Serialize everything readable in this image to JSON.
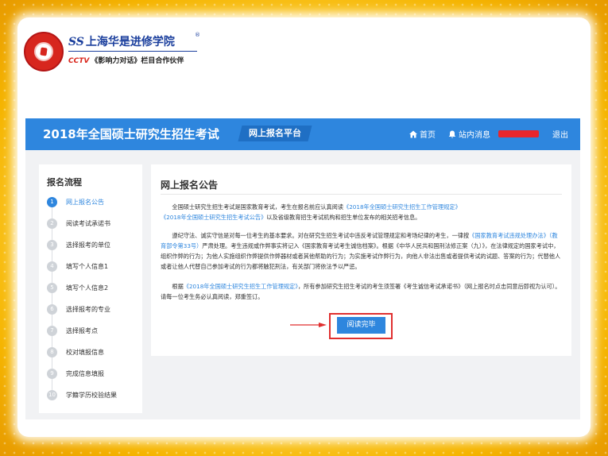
{
  "logo": {
    "school_mark": "SS",
    "school_name": "上海华是进修学院",
    "registered": "®",
    "partner_channel": "CCTV",
    "partner_program": "《影响力对话》",
    "partner_suffix": "栏目合作伙伴"
  },
  "header": {
    "title": "2018年全国硕士研究生招生考试",
    "platform_tag": "网上报名平台",
    "nav": {
      "home": "首页",
      "messages": "站内消息",
      "logout": "退出"
    },
    "colors": {
      "banner": "#2e86de",
      "redaction": "#e8262c"
    }
  },
  "sidebar": {
    "title": "报名流程",
    "steps": [
      {
        "num": "1",
        "label": "网上报名公告"
      },
      {
        "num": "2",
        "label": "阅读考试承诺书"
      },
      {
        "num": "3",
        "label": "选择报考的单位"
      },
      {
        "num": "4",
        "label": "填写个人信息1"
      },
      {
        "num": "5",
        "label": "填写个人信息2"
      },
      {
        "num": "6",
        "label": "选择报考的专业"
      },
      {
        "num": "7",
        "label": "选择报考点"
      },
      {
        "num": "8",
        "label": "校对填报信息"
      },
      {
        "num": "9",
        "label": "完成信息填报"
      },
      {
        "num": "10",
        "label": "学籍学历校验结果"
      }
    ],
    "active_step": 1
  },
  "notice": {
    "title": "网上报名公告",
    "p1": {
      "a": "全国硕士研究生招生考试是国家教育考试，考生在报名前应认真阅读",
      "link1": "《2018年全国硕士研究生招生工作管理规定》",
      "link2": "《2018年全国硕士研究生招生考试公告》",
      "b": "以及省级教育招生考试机构和招生单位发布的相关招考信息。"
    },
    "p2": {
      "a": "遵纪守法、诚实守信是对每一位考生的基本要求。对在研究生招生考试中违反考试管理规定和考场纪律的考生，一律按",
      "link1": "《国家教育考试违规处理办法》（教育部令第33号）",
      "b": "严肃处理。考生违规或作弊事实将记入《国家教育考试考生诚信档案》。根据《中华人民共和国刑法修正案（九）》，在法律规定的国家考试中，组织作弊的行为；为他人实施组织作弊提供作弊器材或者其他帮助的行为；为实施考试作弊行为，向他人非法出售或者提供考试的试题、答案的行为；代替他人或者让他人代替自己参加考试的行为都将触犯刑法，有关部门将依法予以严惩。"
    },
    "p3": {
      "a": "根据",
      "link1": "《2018年全国硕士研究生招生工作管理规定》",
      "b": "，所有参加研究生招生考试的考生须签署《考生诚信考试承诺书》（网上报名时点击同意后即视为认可）。请每一位考生务必认真阅读，郑重签订。"
    },
    "read_button": "阅读完毕"
  }
}
